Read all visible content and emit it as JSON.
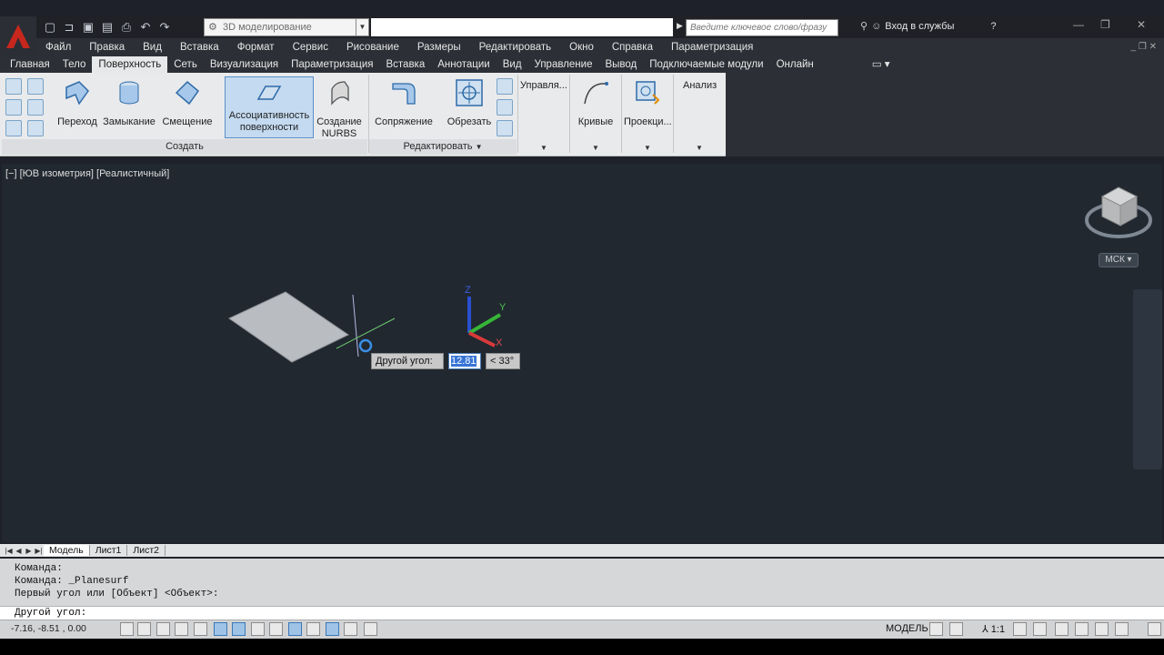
{
  "titlebar": {
    "workspace": "3D моделирование",
    "search_placeholder": "Введите ключевое слово/фразу",
    "signin": "Вход в службы"
  },
  "menu": [
    "Файл",
    "Правка",
    "Вид",
    "Вставка",
    "Формат",
    "Сервис",
    "Рисование",
    "Размеры",
    "Редактировать",
    "Окно",
    "Справка",
    "Параметризация"
  ],
  "tabs": [
    "Главная",
    "Тело",
    "Поверхность",
    "Сеть",
    "Визуализация",
    "Параметризация",
    "Вставка",
    "Аннотации",
    "Вид",
    "Управление",
    "Вывод",
    "Подключаемые модули",
    "Онлайн"
  ],
  "active_tab": "Поверхность",
  "ribbon": {
    "create": {
      "title": "Создать",
      "loft": "Переход",
      "network": "Замыкание",
      "offset": "Смещение",
      "assoc_l1": "Ассоциативность",
      "assoc_l2": "поверхности",
      "nurbs_l1": "Создание",
      "nurbs_l2": "NURBS"
    },
    "edit": {
      "title": "Редактировать",
      "fillet": "Сопряжение",
      "trim": "Обрезать"
    },
    "manage": "Управля...",
    "curves": "Кривые",
    "project": "Проекци...",
    "analysis": "Анализ"
  },
  "viewport": {
    "label": "[−] [ЮВ изометрия] [Реалистичный]",
    "ucs_label": "МСК"
  },
  "dynamic_input": {
    "prompt": "Другой угол:",
    "value": "12.81",
    "angle": "< 33°"
  },
  "layout_tabs": [
    "Модель",
    "Лист1",
    "Лист2"
  ],
  "command": {
    "history": [
      "Команда:",
      "Команда: _Planesurf",
      "Первый угол или [Объект] <Объект>:"
    ],
    "input": "Другой угол:"
  },
  "status": {
    "coords": "-7.16, -8.51 , 0.00",
    "model": "МОДЕЛЬ",
    "scale": "1:1"
  },
  "colors": {
    "accent": "#3875d7",
    "drawing_bg": "#212830",
    "ribbon_bg": "#e9eaec"
  }
}
